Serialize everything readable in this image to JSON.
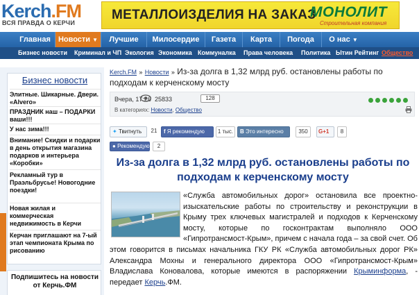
{
  "header": {
    "logo_kerch": "Kerch",
    "logo_fm": ".FM",
    "tagline": "ВСЯ ПРАВДА О КЕРЧИ",
    "banner": {
      "text": "МЕТАЛЛОИЗДЕЛИЯ НА ЗАКАЗ",
      "brand": "МОНОЛИТ",
      "sub": "Строительная компания"
    }
  },
  "nav": {
    "items": [
      "Главная",
      "Новости",
      "Лучшие",
      "Милосердие",
      "Газета",
      "Карта",
      "Погода",
      "О нас"
    ],
    "dropdown_glyph": "▼",
    "active": "Новости"
  },
  "subnav": {
    "items": [
      "Бизнес новости",
      "Криминал и ЧП",
      "Экология",
      "Экономика",
      "Коммуналка",
      "Права человека",
      "Политика",
      "Ытин Рейтинг",
      "Общество"
    ]
  },
  "sidebar": {
    "title": "Бизнес новости",
    "items": [
      "Элитные. Шикарные. Двери. «Alvero»",
      "ПРАЗДНИК наш – ПОДАРКИ ваши!!!",
      "У нас зима!!!",
      "Внимание! Скидки и подарки в день открытия магазина подарков и интерьера «Коробки»",
      "Рекламный тур в Праэльбрусье! Новогодние поездки!",
      "Новая жилая и коммерческая недвижимость в Керчи",
      "Керчан приглашают на 7-ый этап чемпионата Крыма по рисованию"
    ],
    "subscribe": "Подпишитесь на новости от Керчь.ФМ"
  },
  "breadcrumb": {
    "site": "Kerch.FM",
    "sep": "»",
    "section": "Новости",
    "title": "Из-за долга в 1,32 млрд руб. остановлены работы по подходам к керченскому мосту"
  },
  "meta": {
    "date": "Вчера, 17:26",
    "views": "25833",
    "comments": "128",
    "categories_label": "В категориях:",
    "category_1": "Новости",
    "category_2": "Общество",
    "cat_sep": ","
  },
  "share": {
    "twitter_label": "Твитнуть",
    "twitter_count": "21",
    "fb_label": "Я рекомендую",
    "fb_count": "1 тыс.",
    "vk_label": "Это интересно",
    "vk_count": "350",
    "gplus_label": "G+1",
    "gplus_count": "8",
    "reco_label": "Рекомендую",
    "reco_count": "2"
  },
  "article": {
    "title": "Из-за долга в 1,32 млрд руб. остановлены работы по подходам к керченскому мосту",
    "body_1": "«Служба автомобильных дорог» остановила все проектно-изыскательские работы по строительству и реконструкции в Крыму трех ключевых магистралей и подходов к Керченскому мосту, которые по госконтрактам выполняло ООО «Гипротрансмост-Крым», причем с начала года – за свой счет. Об этом говорится в письмах начальника ГКУ РК «Служба автомобильных дорог РК» Александра Мохны и генерального директора ООО «Гипротрансмост-Крым» Владислава Коновалова, которые имеются в распоряжении ",
    "link_1": "Крыминформа",
    "body_2": ", - передает ",
    "link_2": "Керчь",
    "body_3": ".ФМ."
  }
}
